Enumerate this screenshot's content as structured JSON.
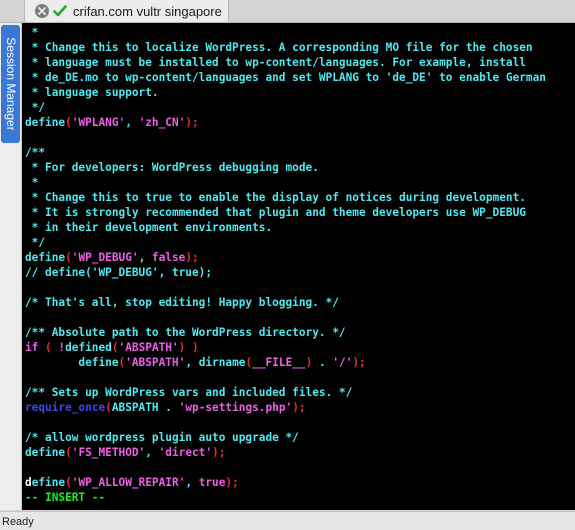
{
  "window": {
    "tab_title": "crifan.com vultr singapore",
    "close_icon": "close-circle-icon",
    "status_icon": "green-checkmark-icon"
  },
  "sidebar": {
    "session_manager_label": "Session Manager"
  },
  "colors": {
    "cyan": "#4ee9f0",
    "pink": "#ee5ee7",
    "red": "#ef2a2a",
    "blue": "#3d46ec",
    "green": "#1ff01d",
    "white": "#ffffff",
    "background": "#000000"
  },
  "editor": {
    "lines": [
      [
        {
          "t": " *",
          "c": "cyan"
        }
      ],
      [
        {
          "t": " * Change this to localize WordPress. A corresponding MO file for the chosen",
          "c": "cyan"
        }
      ],
      [
        {
          "t": " * language must be installed to wp-content/languages. For example, install",
          "c": "cyan"
        }
      ],
      [
        {
          "t": " * de_DE.mo to wp-content/languages and set WPLANG to 'de_DE' to enable German",
          "c": "cyan"
        }
      ],
      [
        {
          "t": " * language support.",
          "c": "cyan"
        }
      ],
      [
        {
          "t": " */",
          "c": "cyan"
        }
      ],
      [
        {
          "t": "define",
          "c": "cyan"
        },
        {
          "t": "(",
          "c": "red"
        },
        {
          "t": "'WPLANG'",
          "c": "pink"
        },
        {
          "t": ", ",
          "c": "cyan"
        },
        {
          "t": "'zh_CN'",
          "c": "pink"
        },
        {
          "t": ");",
          "c": "red"
        }
      ],
      [],
      [
        {
          "t": "/**",
          "c": "cyan"
        }
      ],
      [
        {
          "t": " * For developers: WordPress debugging mode.",
          "c": "cyan"
        }
      ],
      [
        {
          "t": " *",
          "c": "cyan"
        }
      ],
      [
        {
          "t": " * Change this to true to enable the display of notices during development.",
          "c": "cyan"
        }
      ],
      [
        {
          "t": " * It is strongly recommended that plugin and theme developers use WP_DEBUG",
          "c": "cyan"
        }
      ],
      [
        {
          "t": " * in their development environments.",
          "c": "cyan"
        }
      ],
      [
        {
          "t": " */",
          "c": "cyan"
        }
      ],
      [
        {
          "t": "define",
          "c": "cyan"
        },
        {
          "t": "(",
          "c": "red"
        },
        {
          "t": "'WP_DEBUG'",
          "c": "pink"
        },
        {
          "t": ", ",
          "c": "cyan"
        },
        {
          "t": "false",
          "c": "pink"
        },
        {
          "t": ");",
          "c": "red"
        }
      ],
      [
        {
          "t": "// define('WP_DEBUG', true);",
          "c": "cyan"
        }
      ],
      [],
      [
        {
          "t": "/* That's all, stop editing! Happy blogging. */",
          "c": "cyan"
        }
      ],
      [],
      [
        {
          "t": "/** Absolute path to the WordPress directory. */",
          "c": "cyan"
        }
      ],
      [
        {
          "t": "if",
          "c": "pink"
        },
        {
          "t": " ( ",
          "c": "red"
        },
        {
          "t": "!",
          "c": "pink"
        },
        {
          "t": "defined",
          "c": "cyan"
        },
        {
          "t": "(",
          "c": "red"
        },
        {
          "t": "'ABSPATH'",
          "c": "pink"
        },
        {
          "t": ") )",
          "c": "red"
        }
      ],
      [
        {
          "t": "        define",
          "c": "cyan"
        },
        {
          "t": "(",
          "c": "red"
        },
        {
          "t": "'ABSPATH'",
          "c": "pink"
        },
        {
          "t": ", ",
          "c": "cyan"
        },
        {
          "t": "dirname",
          "c": "cyan"
        },
        {
          "t": "(",
          "c": "red"
        },
        {
          "t": "__FILE__",
          "c": "pink"
        },
        {
          "t": ")",
          "c": "red"
        },
        {
          "t": " . ",
          "c": "cyan"
        },
        {
          "t": "'/'",
          "c": "pink"
        },
        {
          "t": ");",
          "c": "red"
        }
      ],
      [],
      [
        {
          "t": "/** Sets up WordPress vars and included files. */",
          "c": "cyan"
        }
      ],
      [
        {
          "t": "require_once",
          "c": "blue"
        },
        {
          "t": "(",
          "c": "red"
        },
        {
          "t": "ABSPATH",
          "c": "cyan"
        },
        {
          "t": " . ",
          "c": "cyan"
        },
        {
          "t": "'wp-settings.php'",
          "c": "pink"
        },
        {
          "t": ");",
          "c": "red"
        }
      ],
      [],
      [
        {
          "t": "/* allow wordpress plugin auto upgrade */",
          "c": "cyan"
        }
      ],
      [
        {
          "t": "define",
          "c": "cyan"
        },
        {
          "t": "(",
          "c": "red"
        },
        {
          "t": "'FS_METHOD'",
          "c": "pink"
        },
        {
          "t": ", ",
          "c": "cyan"
        },
        {
          "t": "'direct'",
          "c": "pink"
        },
        {
          "t": ");",
          "c": "red"
        }
      ],
      [],
      [
        {
          "t": "d",
          "c": "cursor"
        },
        {
          "t": "efine",
          "c": "cyan"
        },
        {
          "t": "(",
          "c": "red"
        },
        {
          "t": "'WP_ALLOW_REPAIR'",
          "c": "pink"
        },
        {
          "t": ", ",
          "c": "cyan"
        },
        {
          "t": "true",
          "c": "pink"
        },
        {
          "t": ");",
          "c": "red"
        }
      ],
      [
        {
          "t": "-- INSERT --",
          "c": "green"
        }
      ]
    ]
  },
  "status_bar": {
    "text": "Ready"
  }
}
